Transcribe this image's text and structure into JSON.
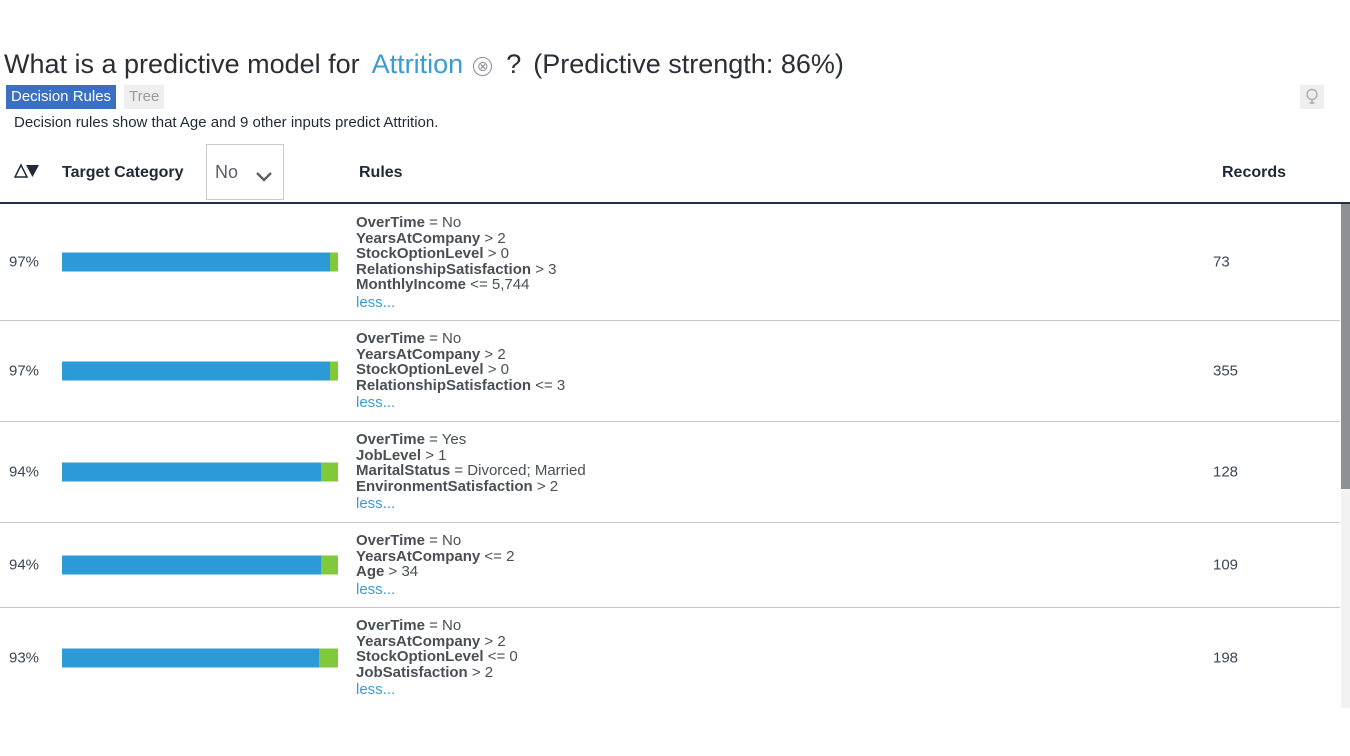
{
  "heading": {
    "prefix": "What is a predictive model for",
    "target": "Attrition",
    "clear_glyph": "⊗",
    "question": "?",
    "strength": "(Predictive strength: 86%)"
  },
  "tabs": [
    {
      "label": "Decision Rules",
      "active": true
    },
    {
      "label": "Tree",
      "active": false
    }
  ],
  "insight_icon": "lightbulb-icon",
  "summary": "Decision rules show that Age and 9 other inputs predict Attrition.",
  "table": {
    "sort_icon": "sort-toggle-icon",
    "target_category_label": "Target Category",
    "target_category_value": "No",
    "rules_label": "Rules",
    "records_label": "Records",
    "rows": [
      {
        "percent": "97%",
        "fraction": 0.97,
        "records": "73",
        "conditions": [
          {
            "field": "OverTime",
            "rule": " = No"
          },
          {
            "field": "YearsAtCompany",
            "rule": " > 2"
          },
          {
            "field": "StockOptionLevel",
            "rule": " > 0"
          },
          {
            "field": "RelationshipSatisfaction",
            "rule": " > 3"
          },
          {
            "field": "MonthlyIncome",
            "rule": " <= 5,744"
          }
        ],
        "toggle": "less..."
      },
      {
        "percent": "97%",
        "fraction": 0.97,
        "records": "355",
        "conditions": [
          {
            "field": "OverTime",
            "rule": " = No"
          },
          {
            "field": "YearsAtCompany",
            "rule": " > 2"
          },
          {
            "field": "StockOptionLevel",
            "rule": " > 0"
          },
          {
            "field": "RelationshipSatisfaction",
            "rule": " <= 3"
          }
        ],
        "toggle": "less..."
      },
      {
        "percent": "94%",
        "fraction": 0.94,
        "records": "128",
        "conditions": [
          {
            "field": "OverTime",
            "rule": " = Yes"
          },
          {
            "field": "JobLevel",
            "rule": " > 1"
          },
          {
            "field": "MaritalStatus",
            "rule": " = Divorced; Married"
          },
          {
            "field": "EnvironmentSatisfaction",
            "rule": " > 2"
          }
        ],
        "toggle": "less..."
      },
      {
        "percent": "94%",
        "fraction": 0.94,
        "records": "109",
        "conditions": [
          {
            "field": "OverTime",
            "rule": " = No"
          },
          {
            "field": "YearsAtCompany",
            "rule": " <= 2"
          },
          {
            "field": "Age",
            "rule": " > 34"
          }
        ],
        "toggle": "less..."
      },
      {
        "percent": "93%",
        "fraction": 0.93,
        "records": "198",
        "conditions": [
          {
            "field": "OverTime",
            "rule": " = No"
          },
          {
            "field": "YearsAtCompany",
            "rule": " > 2"
          },
          {
            "field": "StockOptionLevel",
            "rule": " <= 0"
          },
          {
            "field": "JobSatisfaction",
            "rule": " > 2"
          }
        ],
        "toggle": "less..."
      }
    ]
  },
  "colors": {
    "accent": "#3a9bd5",
    "active_tab": "#3a6fc4",
    "bar_primary": "#2d9ad8",
    "bar_remainder": "#7fc93b",
    "header_rule": "#1f2f44"
  }
}
